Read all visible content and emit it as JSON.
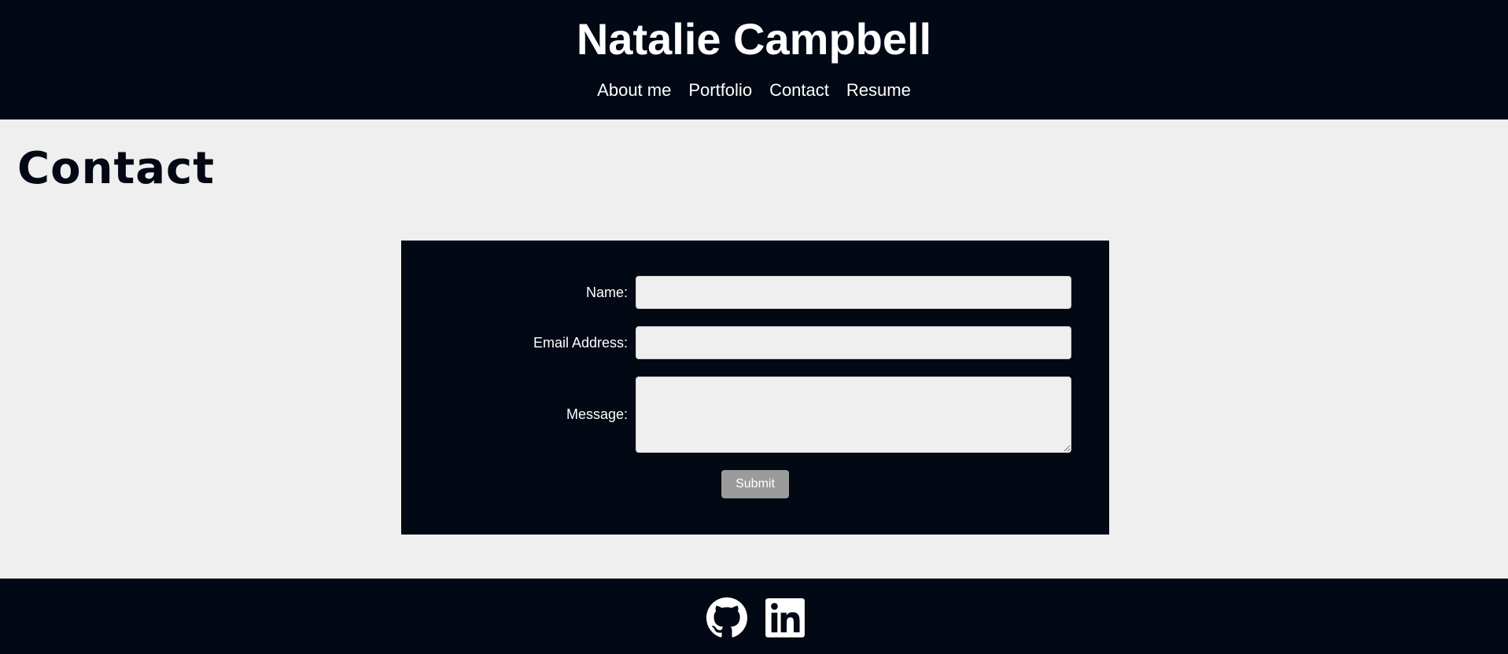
{
  "header": {
    "title": "Natalie Campbell",
    "nav": [
      {
        "label": "About me"
      },
      {
        "label": "Portfolio"
      },
      {
        "label": "Contact"
      },
      {
        "label": "Resume"
      }
    ]
  },
  "main": {
    "page_title": "Contact",
    "form": {
      "name_label": "Name:",
      "name_value": "",
      "email_label": "Email Address:",
      "email_value": "",
      "message_label": "Message:",
      "message_value": "",
      "submit_label": "Submit"
    }
  },
  "footer": {
    "icons": [
      {
        "name": "github-icon"
      },
      {
        "name": "linkedin-icon"
      }
    ]
  },
  "colors": {
    "dark": "#020814",
    "light": "#efefef",
    "button": "#9b9b9b",
    "text_light": "#ffffff"
  }
}
